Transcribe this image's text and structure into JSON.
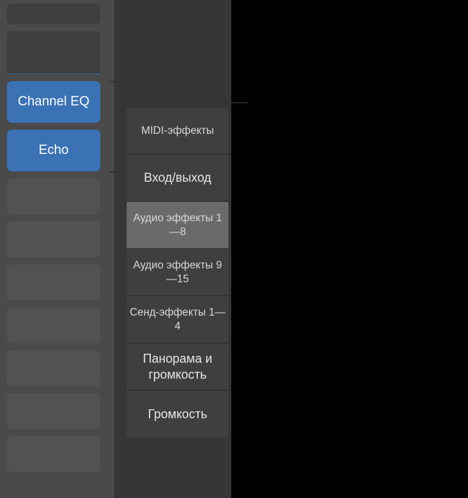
{
  "channel_strip": {
    "plugins": {
      "slot1": "Channel EQ",
      "slot2": "Echo"
    }
  },
  "menu": {
    "items": [
      {
        "label": "MIDI-эффекты",
        "selected": false
      },
      {
        "label": "Вход/выход",
        "selected": false
      },
      {
        "label": "Аудио эффекты 1—8",
        "selected": true
      },
      {
        "label": "Аудио эффекты 9—15",
        "selected": false
      },
      {
        "label": "Сенд-эффекты 1—4",
        "selected": false
      },
      {
        "label": "Панорама и громкость",
        "selected": false
      },
      {
        "label": "Громкость",
        "selected": false
      }
    ]
  }
}
